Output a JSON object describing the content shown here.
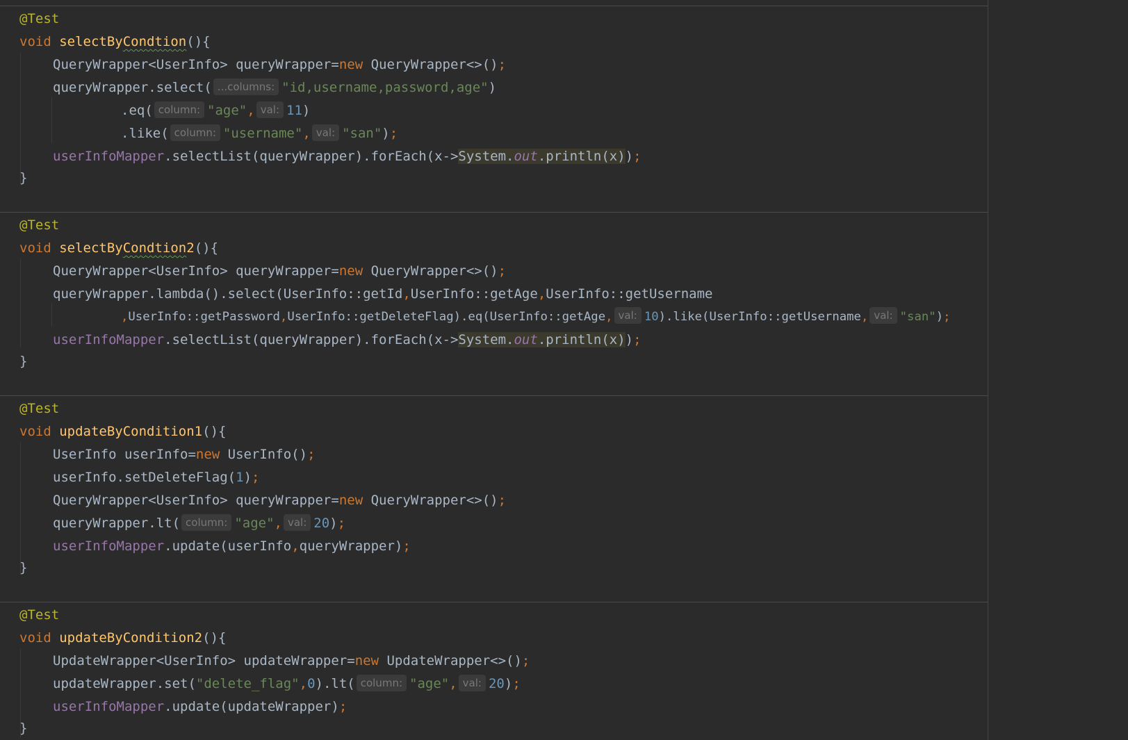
{
  "editor": {
    "methods": [
      {
        "annotation": "@Test",
        "signature": {
          "keyword": "void",
          "name_prefix": "selectBy",
          "name_typo": "Condtion",
          "name_suffix": "",
          "params": "(){"
        },
        "lines": [
          {
            "t": "QueryWrapper<UserInfo> queryWrapper=",
            "kw": "new",
            "t2": " QueryWrapper<>()",
            "semi": ";"
          },
          {
            "t": "queryWrapper.select(",
            "hint": "...columns:",
            "str": "\"id,username,password,age\"",
            "t2": ")"
          },
          {
            "t": ".eq(",
            "hint": "column:",
            "str": "\"age\"",
            "comma": ",",
            "hint2": "val:",
            "num": "11",
            "t2": ")"
          },
          {
            "t": ".like(",
            "hint": "column:",
            "str": "\"username\"",
            "comma": ",",
            "hint2": "val:",
            "str2": "\"san\"",
            "t2": ")",
            "semi": ";"
          },
          {
            "field": "userInfoMapper",
            "t": ".selectList(queryWrapper).forEach(x->",
            "hl_class": "System.",
            "hl_static": "out",
            "hl_tail": ".println(x)",
            "t2": ")",
            "semi": ";"
          }
        ],
        "close": "}"
      },
      {
        "annotation": "@Test",
        "signature": {
          "keyword": "void",
          "name_prefix": "selectBy",
          "name_typo": "Condtion",
          "name_suffix": "2",
          "params": "(){"
        },
        "lines": [
          {
            "t": "QueryWrapper<UserInfo> queryWrapper=",
            "kw": "new",
            "t2": " QueryWrapper<>()",
            "semi": ";"
          },
          {
            "t": "queryWrapper.lambda().select(UserInfo::getId",
            "c1": ",",
            "t_b": "UserInfo::getAge",
            "c2": ",",
            "t_c": "UserInfo::getUsername"
          },
          {
            "c0": ",",
            "t": "UserInfo::getPassword",
            "c1": ",",
            "t_b": "UserInfo::getDeleteFlag).eq(UserInfo::getAge",
            "c2": ",",
            "hint": "val:",
            "num": "10",
            "t_c": ").like(UserInfo::getUsername",
            "c3": ",",
            "hint2": "val:",
            "str": "\"san\"",
            "t2": ")",
            "semi": ";"
          },
          {
            "field": "userInfoMapper",
            "t": ".selectList(queryWrapper).forEach(x->",
            "hl_class": "System.",
            "hl_static": "out",
            "hl_tail": ".println(x)",
            "t2": ")",
            "semi": ";"
          }
        ],
        "close": "}"
      },
      {
        "annotation": "@Test",
        "signature": {
          "keyword": "void",
          "name": "updateByCondition1",
          "params": "(){"
        },
        "lines": [
          {
            "t": "UserInfo userInfo=",
            "kw": "new",
            "t2": " UserInfo()",
            "semi": ";"
          },
          {
            "t": "userInfo.setDeleteFlag(",
            "num": "1",
            "t2": ")",
            "semi": ";"
          },
          {
            "t": "QueryWrapper<UserInfo> queryWrapper=",
            "kw": "new",
            "t2": " QueryWrapper<>()",
            "semi": ";"
          },
          {
            "t": "queryWrapper.lt(",
            "hint": "column:",
            "str": "\"age\"",
            "comma": ",",
            "hint2": "val:",
            "num": "20",
            "t2": ")",
            "semi": ";"
          },
          {
            "field": "userInfoMapper",
            "t": ".update(userInfo",
            "comma": ",",
            "t2": "queryWrapper)",
            "semi": ";"
          }
        ],
        "close": "}"
      },
      {
        "annotation": "@Test",
        "signature": {
          "keyword": "void",
          "name": "updateByCondition2",
          "params": "(){"
        },
        "lines": [
          {
            "t": "UpdateWrapper<UserInfo> updateWrapper=",
            "kw": "new",
            "t2": " UpdateWrapper<>()",
            "semi": ";"
          },
          {
            "t": "updateWrapper.set(",
            "str": "\"delete_flag\"",
            "comma": ",",
            "num": "0",
            "t_b": ").lt(",
            "hint": "column:",
            "str2": "\"age\"",
            "comma2": ",",
            "hint2": "val:",
            "num2": "20",
            "t2": ")",
            "semi": ";"
          },
          {
            "field": "userInfoMapper",
            "t": ".update(updateWrapper)",
            "semi": ";"
          }
        ],
        "close": "}"
      }
    ]
  },
  "colors": {
    "background": "#2b2b2b",
    "annotation": "#bbb529",
    "keyword": "#cc7832",
    "method_name": "#ffc66d",
    "string": "#6a8759",
    "number": "#6897bb",
    "field": "#9876aa",
    "plain": "#a9b7c6"
  }
}
